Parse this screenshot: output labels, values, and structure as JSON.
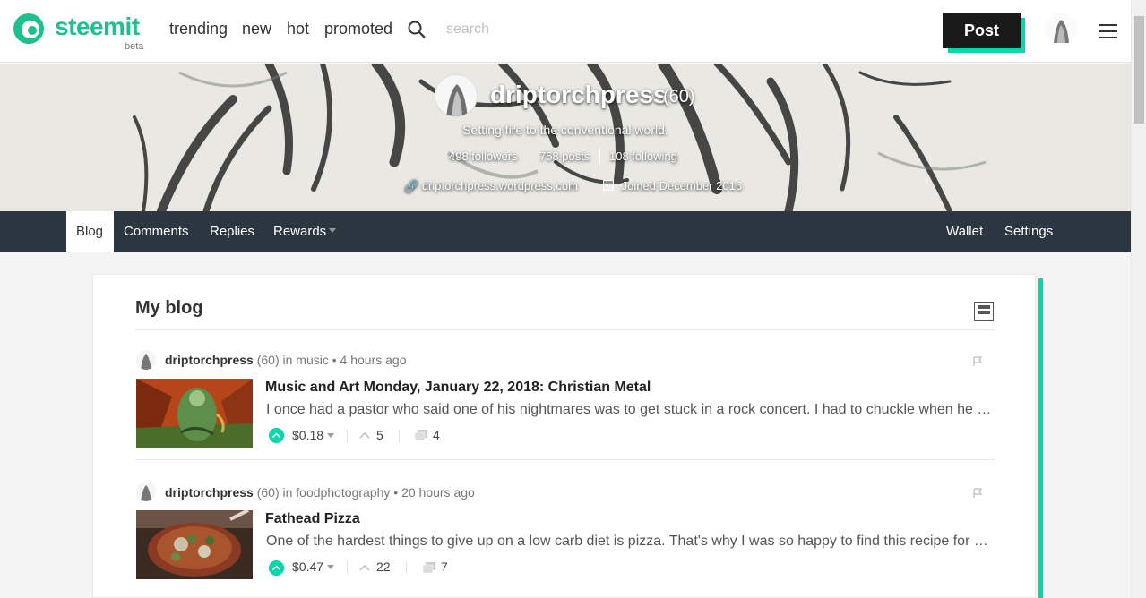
{
  "header": {
    "brand": "steemit",
    "beta": "beta",
    "nav": [
      "trending",
      "new",
      "hot",
      "promoted"
    ],
    "search_placeholder": "search",
    "post_button": "Post",
    "accent_color": "#06d6a9",
    "icons": [
      "steemit-logo-icon",
      "search-icon",
      "user-avatar",
      "hamburger-menu-icon"
    ]
  },
  "profile": {
    "name": "driptorchpress",
    "reputation": "(60)",
    "about": "Setting fire to the conventional world.",
    "followers": "498 followers",
    "posts": "758 posts",
    "following": "108 following",
    "website": "driptorchpress.wordpress.com",
    "joined": "Joined December 2016"
  },
  "tabs": {
    "blog": "Blog",
    "comments": "Comments",
    "replies": "Replies",
    "rewards": "Rewards",
    "wallet": "Wallet",
    "settings": "Settings",
    "active": "Blog"
  },
  "blog": {
    "title": "My blog",
    "posts": [
      {
        "author": "driptorchpress",
        "rep": "(60)",
        "in_label": "in",
        "category": "music",
        "time": "• 4 hours ago",
        "title": "Music and Art Monday, January 22, 2018: Christian Metal",
        "body": "I once had a pastor who said one of his nightmares was to get stuck in a rock concert. I had to chuckle when he told me this, I mean, what could be so bad about rock music?",
        "payout": "$0.18",
        "votes": "5",
        "comments": "4"
      },
      {
        "author": "driptorchpress",
        "rep": "(60)",
        "in_label": "in",
        "category": "foodphotography",
        "time": "• 20 hours ago",
        "title": "Fathead Pizza",
        "body": "One of the hardest things to give up on a low carb diet is pizza. That's why I was so happy to find this recipe for fathead pizza crust.",
        "payout": "$0.47",
        "votes": "22",
        "comments": "7"
      }
    ]
  }
}
